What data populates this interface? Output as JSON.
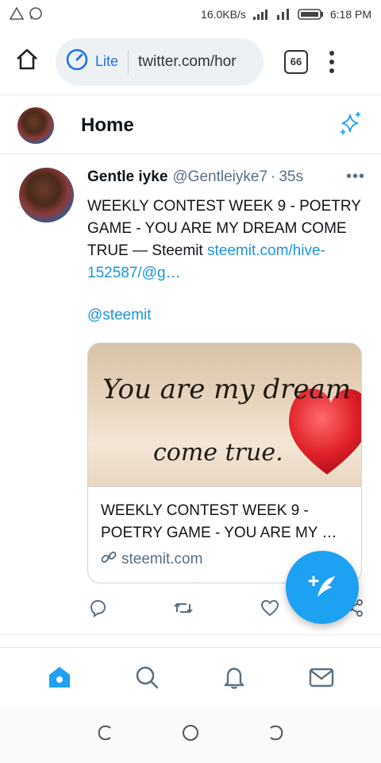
{
  "status_bar": {
    "speed": "16.0KB/s",
    "battery": "",
    "time": "6:18 PM"
  },
  "browser": {
    "mode_label": "Lite",
    "url": "twitter.com/hor",
    "tab_count": "66"
  },
  "header": {
    "title": "Home"
  },
  "tweet": {
    "author_name": "Gentle iyke",
    "handle": "@Gentleiyke7",
    "separator": "·",
    "time": "35s",
    "more": "•••",
    "text": "WEEKLY CONTEST WEEK 9 - POETRY GAME - YOU ARE MY DREAM COME TRUE — Steemit ",
    "link": "steemit.com/hive-152587/@g…",
    "mention": "@steemit",
    "card": {
      "image_line1": "You are my dream",
      "image_line2": "come true.",
      "title": "WEEKLY CONTEST WEEK 9 - POETRY GAME - YOU ARE MY …",
      "domain": "steemit.com"
    }
  },
  "colors": {
    "accent": "#1da1f2",
    "link": "#1b95e0",
    "secondary_text": "#5b7083"
  }
}
